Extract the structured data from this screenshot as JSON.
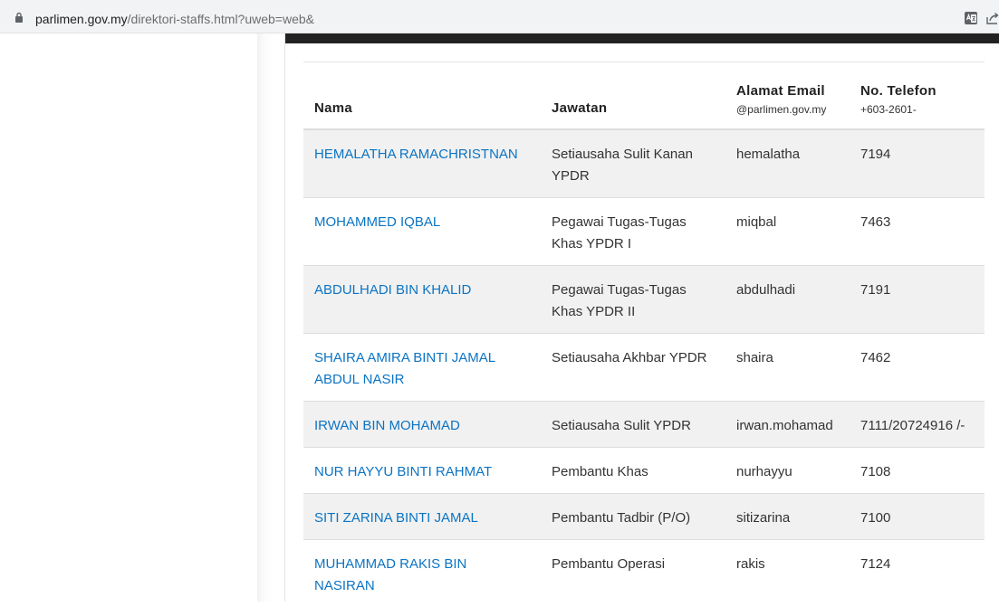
{
  "browser": {
    "url_host": "parlimen.gov.my",
    "url_path": "/direktori-staffs.html?uweb=web&"
  },
  "table": {
    "headers": {
      "name": "Nama",
      "position": "Jawatan",
      "email": "Alamat Email",
      "email_sub": "@parlimen.gov.my",
      "phone": "No. Telefon",
      "phone_sub": "+603-2601-"
    },
    "rows": [
      {
        "name": "HEMALATHA RAMACHRISTNAN",
        "position": "Setiausaha Sulit Kanan YPDR",
        "email": "hemalatha",
        "phone": "7194"
      },
      {
        "name": "MOHAMMED IQBAL",
        "position": "Pegawai Tugas-Tugas Khas YPDR I",
        "email": "miqbal",
        "phone": "7463"
      },
      {
        "name": "ABDULHADI BIN KHALID",
        "position": "Pegawai Tugas-Tugas Khas YPDR II",
        "email": "abdulhadi",
        "phone": "7191"
      },
      {
        "name": "SHAIRA AMIRA BINTI JAMAL ABDUL NASIR",
        "position": "Setiausaha Akhbar YPDR",
        "email": "shaira",
        "phone": "7462"
      },
      {
        "name": "IRWAN BIN MOHAMAD",
        "position": "Setiausaha Sulit YPDR",
        "email": "irwan.mohamad",
        "phone": "7111/20724916 /-"
      },
      {
        "name": "NUR HAYYU BINTI RAHMAT",
        "position": "Pembantu Khas",
        "email": "nurhayyu",
        "phone": "7108"
      },
      {
        "name": "SITI ZARINA BINTI JAMAL",
        "position": "Pembantu Tadbir (P/O)",
        "email": "sitizarina",
        "phone": "7100"
      },
      {
        "name": "MUHAMMAD RAKIS BIN NASIRAN",
        "position": "Pembantu Operasi",
        "email": "rakis",
        "phone": "7124"
      }
    ]
  },
  "icons": {
    "lock": "lock-icon",
    "translate": "translate-icon",
    "share": "share-icon"
  }
}
